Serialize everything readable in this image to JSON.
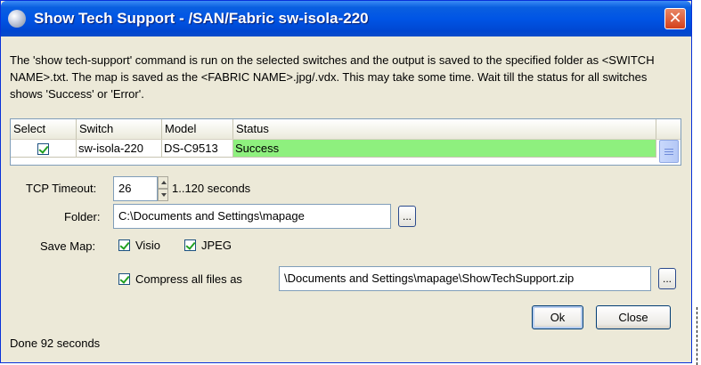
{
  "window": {
    "title": "Show Tech Support - /SAN/Fabric sw-isola-220",
    "close_label": "✕"
  },
  "description": "The 'show tech-support' command is run on the selected switches and the output is saved to the specified folder as <SWITCH NAME>.txt. The map is saved as the <FABRIC NAME>.jpg/.vdx. This may take some time. Wait till the status for all switches shows 'Success' or 'Error'.",
  "table": {
    "columns": [
      "Select",
      "Switch",
      "Model",
      "Status"
    ],
    "rows": [
      {
        "selected": true,
        "switch": "sw-isola-220",
        "model": "DS-C9513",
        "status": "Success"
      }
    ],
    "status_color": "#8ef07e"
  },
  "tcp_timeout": {
    "label": "TCP Timeout:",
    "value": "26",
    "range_hint": "1..120 seconds"
  },
  "folder": {
    "label": "Folder:",
    "value": "C:\\Documents and Settings\\mapage",
    "browse_label": "..."
  },
  "save_map": {
    "label": "Save Map:",
    "visio": {
      "label": "Visio",
      "checked": true
    },
    "jpeg": {
      "label": "JPEG",
      "checked": true
    }
  },
  "compress": {
    "label": "Compress all files as",
    "checked": true,
    "value": "\\Documents and Settings\\mapage\\ShowTechSupport.zip",
    "browse_label": "..."
  },
  "buttons": {
    "ok": "Ok",
    "close": "Close"
  },
  "status_text": "Done 92 seconds"
}
